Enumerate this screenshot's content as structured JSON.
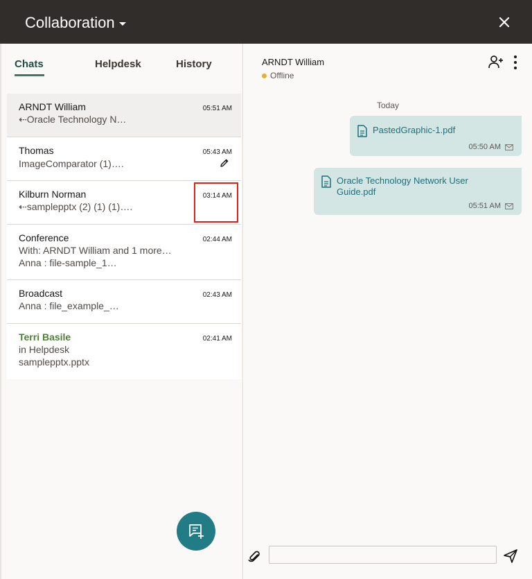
{
  "header": {
    "title": "Collaboration"
  },
  "tabs": [
    "Chats",
    "Helpdesk",
    "History"
  ],
  "chats": [
    {
      "name": "ARNDT William",
      "lines": [
        "⇠Oracle Technology N…"
      ],
      "time": "05:51 AM"
    },
    {
      "name": "Thomas",
      "lines": [
        "ImageComparator (1)…."
      ],
      "time": "05:43 AM"
    },
    {
      "name": "Kilburn Norman",
      "lines": [
        "⇠samplepptx (2) (1) (1)…."
      ],
      "time": "03:14 AM"
    },
    {
      "name": "Conference",
      "lines": [
        "With: ARNDT William and 1 more…",
        "Anna : file-sample_1…"
      ],
      "time": "02:44 AM"
    },
    {
      "name": "Broadcast",
      "lines": [
        "Anna : file_example_…"
      ],
      "time": "02:43 AM"
    },
    {
      "name": "Terri Basile",
      "lines": [
        "in Helpdesk",
        "samplepptx.pptx"
      ],
      "time": "02:41 AM"
    }
  ],
  "conversation": {
    "contact_name": "ARNDT William",
    "status": "Offline",
    "day_label": "Today",
    "messages": [
      {
        "file_lines": [
          "PastedGraphic-1.pdf"
        ],
        "time": "05:50 AM"
      },
      {
        "file_lines": [
          "Oracle Technology Network User",
          "Guide.pdf"
        ],
        "time": "05:51 AM"
      }
    ],
    "input_value": ""
  },
  "colors": {
    "header_bg": "#312d2a",
    "accent_teal": "#227c85",
    "bubble_bg": "#d3e6e4",
    "highlight_red": "#e0201b",
    "status_dot": "#e0b23a"
  }
}
